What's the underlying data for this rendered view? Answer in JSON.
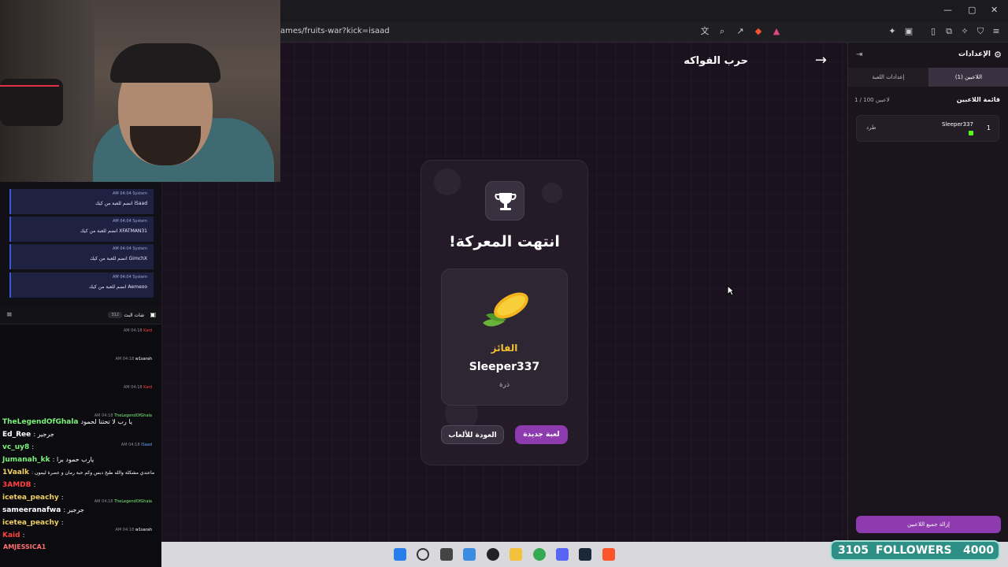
{
  "browser": {
    "url": "ames/fruits-war?kick=isaad"
  },
  "game": {
    "title": "حرب الفواكه",
    "card_title": "انتهت المعركة!",
    "winner_label": "الفائز",
    "winner_name": "Sleeper337",
    "winner_fruit": "ذرة",
    "back_button": "العودة للألعاب",
    "new_game_button": "لعبة جديدة"
  },
  "settings_panel": {
    "title": "الإعدادات",
    "tabs": [
      "إعدادات اللعبة",
      "اللاعبين (1)"
    ],
    "players_heading": "قائمة اللاعبين",
    "players_count": "1 / 100 لاعبين",
    "players": [
      {
        "number": "1",
        "name": "Sleeper337",
        "kick_label": "طرد"
      }
    ],
    "remove_all_button": "إزالة جميع اللاعبين"
  },
  "system_chat": [
    {
      "time": "AM 04:04",
      "sender": "System",
      "text": "iSaad انضم للعبة من كيك"
    },
    {
      "time": "AM 04:04",
      "sender": "System",
      "text": "XFATMAN31 انضم للعبة من كيك"
    },
    {
      "time": "AM 04:04",
      "sender": "System",
      "text": "GimchX انضم للعبة من كيك"
    },
    {
      "time": "AM 04:04",
      "sender": "System",
      "text": "Aemeoo انضم للعبة من كيك"
    }
  ],
  "chat_header": {
    "label": "شات البث",
    "count": "312"
  },
  "chat_meta": [
    {
      "time": "AM 04:18",
      "user": "Kaid"
    },
    {
      "time": "AM 04:18",
      "user": "w1sarah"
    },
    {
      "time": "AM 04:18",
      "user": "Kaid"
    },
    {
      "time": "AM 04:18",
      "user": "TheLegendOfGhala"
    },
    {
      "time": "AM 04:18",
      "user": "iSaad"
    },
    {
      "time": "AM 04:18",
      "user": "TheLegendOfGhala"
    },
    {
      "time": "AM 04:18",
      "user": "w1sarah"
    }
  ],
  "chat_lines": [
    {
      "name": "TheLegendOfGhala",
      "text": "يا رب لا تحتنا لحمود",
      "color": "#7cf27a"
    },
    {
      "name": "Ed_Ree",
      "text": ": جرجير",
      "color": "#ffffff"
    },
    {
      "name": "vc_uy8",
      "text": ":",
      "color": "#7cf27a"
    },
    {
      "name": "Jumanah_kk",
      "text": ": يارب حمود برا",
      "color": "#7cf27a"
    },
    {
      "name": "1Vaalk",
      "text": ": ماعندي مشكلة والله طبخ دبس وكم حبة رمان و عصرة ليمون",
      "color": "#f0d060"
    },
    {
      "name": "3AMDB",
      "text": ":",
      "color": "#ff4040"
    },
    {
      "name": "icetea_peachy",
      "text": ":",
      "color": "#f0d060"
    },
    {
      "name": "sameeranafwa",
      "text": ": جرجير",
      "color": "#ffffff"
    },
    {
      "name": "icetea_peachy",
      "text": ":",
      "color": "#f0d060"
    },
    {
      "name": "Kaid",
      "text": ":",
      "color": "#ff4040"
    }
  ],
  "bottom_user": "AMJESSICA1",
  "followers": {
    "count": "3105",
    "label": "FOLLOWERS",
    "goal": "4000"
  },
  "colors": {
    "accent": "#8e3bb0",
    "winner_gold": "#f2c230",
    "followers_bg": "#2d8f86"
  }
}
